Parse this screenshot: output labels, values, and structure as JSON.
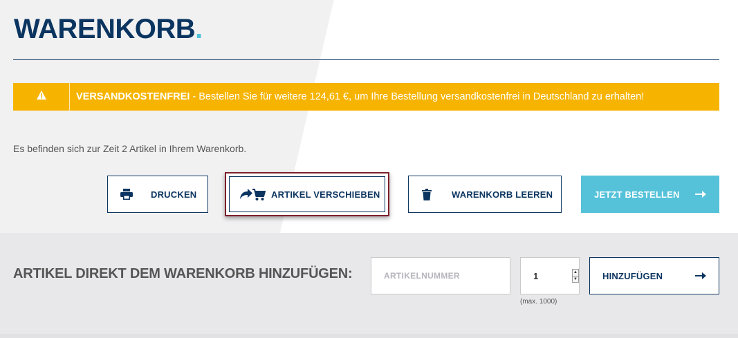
{
  "header": {
    "title": "WARENKORB",
    "title_dot": "."
  },
  "alert": {
    "icon": "warning-icon",
    "strong": "VERSANDKOSTENFREI",
    "text": " - Bestellen Sie für weitere 124,61 €, um Ihre Bestellung versandkostenfrei in Deutschland zu erhalten!",
    "color": "#f6b400"
  },
  "cart": {
    "info": "Es befinden sich zur Zeit 2 Artikel in Ihrem Warenkorb."
  },
  "actions": {
    "print_label": "DRUCKEN",
    "move_label": "ARTIKEL VERSCHIEBEN",
    "empty_label": "WARENKORB LEEREN",
    "order_label": "JETZT BESTELLEN"
  },
  "quick_add": {
    "title": "ARTIKEL DIREKT DEM WARENKORB HINZUFÜGEN:",
    "article_placeholder": "ARTIKELNUMMER",
    "quantity": "1",
    "quantity_hint": "(max. 1000)",
    "add_label": "HINZUFÜGEN"
  },
  "colors": {
    "brand": "#0b3560",
    "accent": "#55c2d9",
    "highlight_border": "#7d1f2a"
  }
}
